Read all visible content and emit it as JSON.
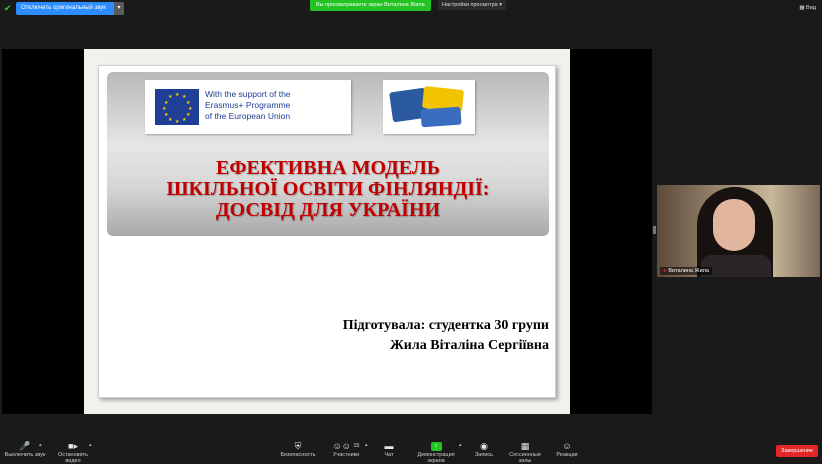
{
  "topbar": {
    "original_sound_label": "Отключить оригинальный звук",
    "viewing_label": "Вы просматриваете экран Виталина Жила",
    "view_options_label": "Настройки просмотра",
    "view_label": "Вид"
  },
  "slide": {
    "eu_logo_text": [
      "With the support of the",
      "Erasmus+ Programme",
      "of the European Union"
    ],
    "title_lines": [
      "ЕФЕКТИВНА МОДЕЛЬ",
      "ШКІЛЬНОЇ ОСВІТИ ФІНЛЯНДІЇ:",
      "ДОСВІД ДЛЯ УКРАЇНИ"
    ],
    "author_lines": [
      "Підготувала: студентка 30 групи",
      "Жила Віталіна Сергіївна"
    ]
  },
  "participant": {
    "name": "Виталина Жила"
  },
  "toolbar": {
    "mute_label": "Выключить звук",
    "stop_video_label": "Остановить видео",
    "security_label": "Безопасность",
    "participants_label": "Участники",
    "participants_count": "15",
    "chat_label": "Чат",
    "share_screen_label": "Демонстрация экрана",
    "record_label": "Запись",
    "breakout_label": "Сессионные залы",
    "reactions_label": "Реакции",
    "end_label": "Завершение"
  },
  "colors": {
    "accent": "#2d8cff",
    "share_green": "#22c322",
    "end_red": "#e02828",
    "title_red": "#c00000",
    "eu_blue": "#1f3f96"
  }
}
